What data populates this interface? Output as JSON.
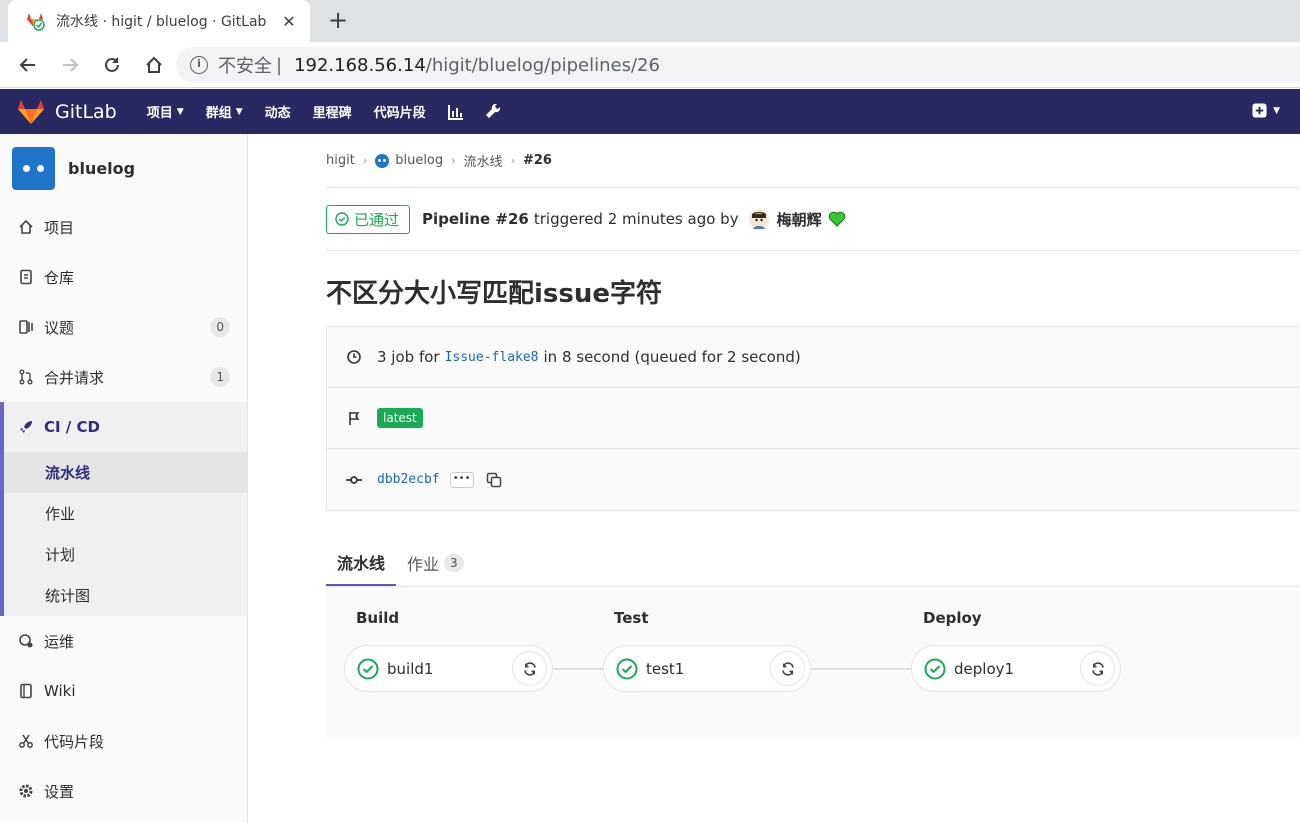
{
  "browser": {
    "tab_title": "流水线 · higit / bluelog · GitLab",
    "url_insecure": "不安全",
    "url_separator": "|",
    "url_host": "192.168.56.14",
    "url_path": "/higit/bluelog/pipelines/26"
  },
  "header": {
    "logo_text": "GitLab",
    "nav": [
      {
        "label": "项目",
        "caret": true
      },
      {
        "label": "群组",
        "caret": true
      },
      {
        "label": "动态",
        "caret": false
      },
      {
        "label": "里程碑",
        "caret": false
      },
      {
        "label": "代码片段",
        "caret": false
      }
    ]
  },
  "sidebar": {
    "project_name": "bluelog",
    "items": [
      {
        "label": "项目",
        "icon": "home-icon"
      },
      {
        "label": "仓库",
        "icon": "repository-icon"
      },
      {
        "label": "议题",
        "icon": "issues-icon",
        "badge": "0"
      },
      {
        "label": "合并请求",
        "icon": "merge-request-icon",
        "badge": "1"
      }
    ],
    "cicd": {
      "label": "CI / CD",
      "icon": "rocket-icon",
      "subitems": [
        "流水线",
        "作业",
        "计划",
        "统计图"
      ]
    },
    "items_bottom": [
      {
        "label": "运维",
        "icon": "operations-icon"
      },
      {
        "label": "Wiki",
        "icon": "book-icon"
      },
      {
        "label": "代码片段",
        "icon": "snippet-icon"
      },
      {
        "label": "设置",
        "icon": "settings-icon"
      }
    ]
  },
  "breadcrumb": {
    "group": "higit",
    "project": "bluelog",
    "section": "流水线",
    "current": "#26"
  },
  "pipeline": {
    "status": "已通过",
    "title": "Pipeline #26",
    "triggered_text": "triggered 2 minutes ago by",
    "user_name": "梅朝辉",
    "commit_title": "不区分大小写匹配issue字符",
    "jobs_summary_pre": "3 job for",
    "branch": "Issue-flake8",
    "jobs_summary_post": "in 8 second (queued for 2 second)",
    "latest_label": "latest",
    "sha": "dbb2ecbf",
    "more_label": "•••"
  },
  "tabs": [
    {
      "label": "流水线",
      "active": true
    },
    {
      "label": "作业",
      "count": "3",
      "active": false
    }
  ],
  "stages": [
    {
      "name": "Build",
      "job": "build1"
    },
    {
      "name": "Test",
      "job": "test1"
    },
    {
      "name": "Deploy",
      "job": "deploy1"
    }
  ],
  "colors": {
    "header_bg": "#292961",
    "success": "#1aaa55",
    "link": "#1b69b6",
    "active_tab": "#6b4fbb"
  }
}
